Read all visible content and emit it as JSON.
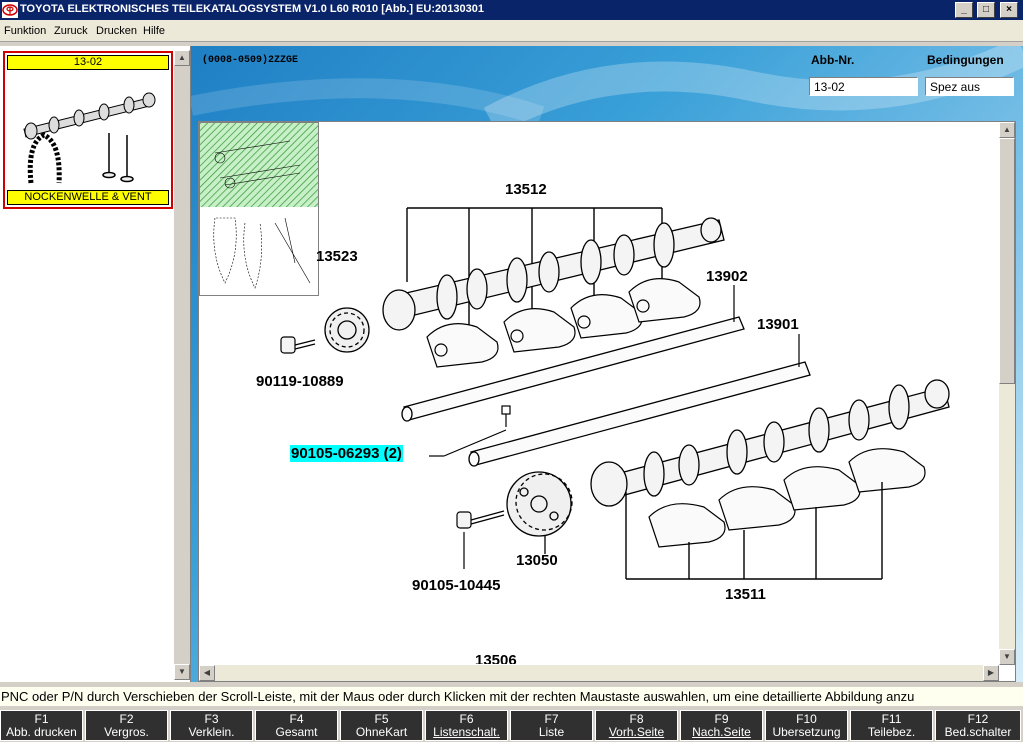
{
  "window": {
    "title": "TOYOTA ELEKTRONISCHES TEILEKATALOGSYSTEM V1.0 L60 R010 [Abb.] EU:20130301",
    "minimize": "_",
    "maximize": "□",
    "close": "×"
  },
  "menu": [
    "Funktion",
    "Zuruck",
    "Drucken",
    "Hilfe"
  ],
  "thumbnail": {
    "code": "13-02",
    "caption": "NOCKENWELLE & VENT"
  },
  "header": {
    "model": "(0008-0509)2ZZGE",
    "abb_label": "Abb-Nr.",
    "abb_value": "13-02",
    "bed_label": "Bedingungen",
    "bed_value": "Spez aus"
  },
  "callouts": {
    "c13512": "13512",
    "c13523": "13523",
    "c13902": "13902",
    "c13901": "13901",
    "c90119": "90119-10889",
    "c90105a": "90105-06293 (2)",
    "c13050": "13050",
    "c90105b": "90105-10445",
    "c13511": "13511",
    "c13506": "13506"
  },
  "status": "PNC oder P/N durch Verschieben der Scroll-Leiste, mit der Maus oder durch Klicken mit der rechten Maustaste auswahlen, um eine detaillierte Abbildung anzu",
  "fkeys": [
    {
      "key": "F1",
      "label": "Abb. drucken"
    },
    {
      "key": "F2",
      "label": "Vergros."
    },
    {
      "key": "F3",
      "label": "Verklein."
    },
    {
      "key": "F4",
      "label": "Gesamt"
    },
    {
      "key": "F5",
      "label": "OhneKart"
    },
    {
      "key": "F6",
      "label": "Listenschalt."
    },
    {
      "key": "F7",
      "label": "Liste"
    },
    {
      "key": "F8",
      "label": "Vorh.Seite"
    },
    {
      "key": "F9",
      "label": "Nach.Seite"
    },
    {
      "key": "F10",
      "label": "Ubersetzung"
    },
    {
      "key": "F11",
      "label": "Teilebez."
    },
    {
      "key": "F12",
      "label": "Bed.schalter"
    }
  ],
  "colors": {
    "titlebar": "#0a246a",
    "highlight": "#00ffff",
    "thumb_border": "#d00000",
    "thumb_band": "#ffff00"
  }
}
